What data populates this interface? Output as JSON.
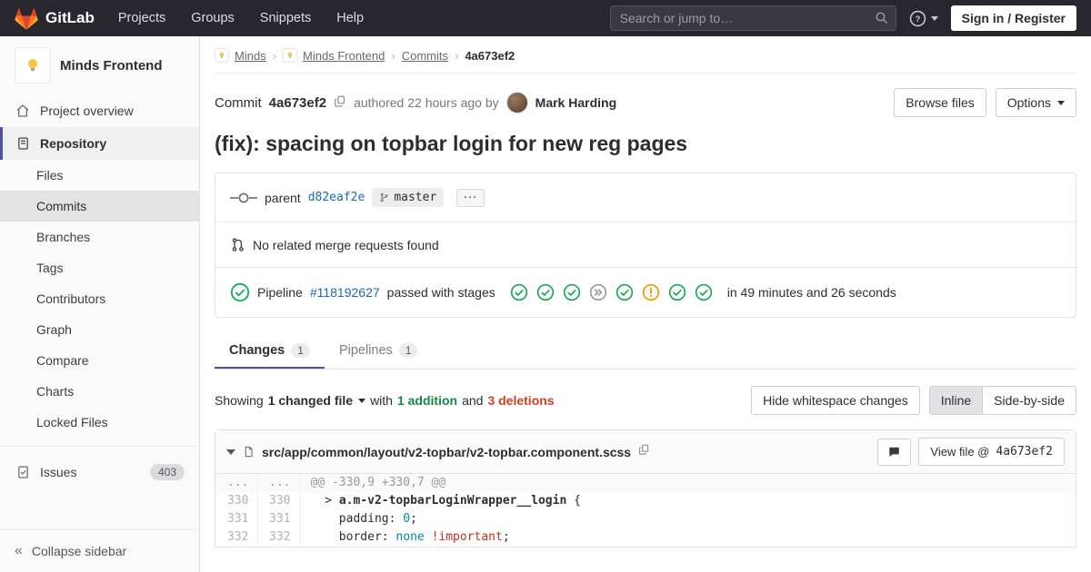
{
  "navbar": {
    "brand": "GitLab",
    "menu": [
      "Projects",
      "Groups",
      "Snippets",
      "Help"
    ],
    "search_placeholder": "Search or jump to…",
    "signin": "Sign in / Register"
  },
  "sidebar": {
    "project": "Minds Frontend",
    "overview": "Project overview",
    "repository": "Repository",
    "repo_items": [
      {
        "label": "Files",
        "active": false
      },
      {
        "label": "Commits",
        "active": true
      },
      {
        "label": "Branches",
        "active": false
      },
      {
        "label": "Tags",
        "active": false
      },
      {
        "label": "Contributors",
        "active": false
      },
      {
        "label": "Graph",
        "active": false
      },
      {
        "label": "Compare",
        "active": false
      },
      {
        "label": "Charts",
        "active": false
      },
      {
        "label": "Locked Files",
        "active": false
      }
    ],
    "issues": "Issues",
    "issues_count": "403",
    "collapse": "Collapse sidebar"
  },
  "breadcrumb": {
    "separator": "›",
    "items": [
      {
        "label": "Minds",
        "avatar": true,
        "current": false
      },
      {
        "label": "Minds Frontend",
        "avatar": true,
        "current": false
      },
      {
        "label": "Commits",
        "avatar": false,
        "current": false
      },
      {
        "label": "4a673ef2",
        "avatar": false,
        "current": true
      }
    ]
  },
  "commit": {
    "label": "Commit",
    "sha": "4a673ef2",
    "authored": "authored 22 hours ago by",
    "author": "Mark Harding",
    "browse_files": "Browse files",
    "options": "Options",
    "title": "(fix): spacing on topbar login for new reg pages"
  },
  "details": {
    "parent_label": "parent",
    "parent_sha": "d82eaf2e",
    "branch": "master",
    "expand": "···",
    "mr_text": "No related merge requests found",
    "pipeline": {
      "prefix": "Pipeline",
      "id": "#118192627",
      "status_text": "passed with stages",
      "stages": [
        "passed",
        "passed",
        "passed",
        "skipped",
        "passed",
        "warning",
        "passed",
        "passed"
      ],
      "duration": "in 49 minutes and 26 seconds"
    }
  },
  "tabs": [
    {
      "label": "Changes",
      "count": "1",
      "active": true
    },
    {
      "label": "Pipelines",
      "count": "1",
      "active": false
    }
  ],
  "diffbar": {
    "showing": "Showing",
    "changed_files": "1 changed file",
    "with": "with",
    "additions": "1 addition",
    "and": "and",
    "deletions": "3 deletions",
    "hide_whitespace": "Hide whitespace changes",
    "inline": "Inline",
    "side_by_side": "Side-by-side"
  },
  "diff": {
    "file_path": "src/app/common/layout/v2-topbar/v2-topbar.component.scss",
    "view_file": "View file @",
    "view_file_sha": "4a673ef2",
    "hunk": "@@ -330,9 +330,7 @@",
    "dots": "...",
    "lines": [
      {
        "old": "330",
        "new": "330",
        "segs": [
          {
            "t": "  > ",
            "c": "pln"
          },
          {
            "t": "a.m-v2-topbarLoginWrapper__login",
            "c": "sel"
          },
          {
            "t": " {",
            "c": "pln"
          }
        ]
      },
      {
        "old": "331",
        "new": "331",
        "segs": [
          {
            "t": "    padding: ",
            "c": "pln"
          },
          {
            "t": "0",
            "c": "val"
          },
          {
            "t": ";",
            "c": "pln"
          }
        ]
      },
      {
        "old": "332",
        "new": "332",
        "segs": [
          {
            "t": "    border: ",
            "c": "pln"
          },
          {
            "t": "none",
            "c": "val"
          },
          {
            "t": " ",
            "c": "pln"
          },
          {
            "t": "!important",
            "c": "imp"
          },
          {
            "t": ";",
            "c": "pln"
          }
        ]
      }
    ]
  },
  "colors": {
    "navbar_bg": "#28272d",
    "accent_orange": "#fc6d26",
    "link_blue": "#1b69b6",
    "success_green": "#1aaa55",
    "danger_red": "#db3b21",
    "warning_orange": "#fc9403",
    "active_indigo": "#51519f"
  }
}
